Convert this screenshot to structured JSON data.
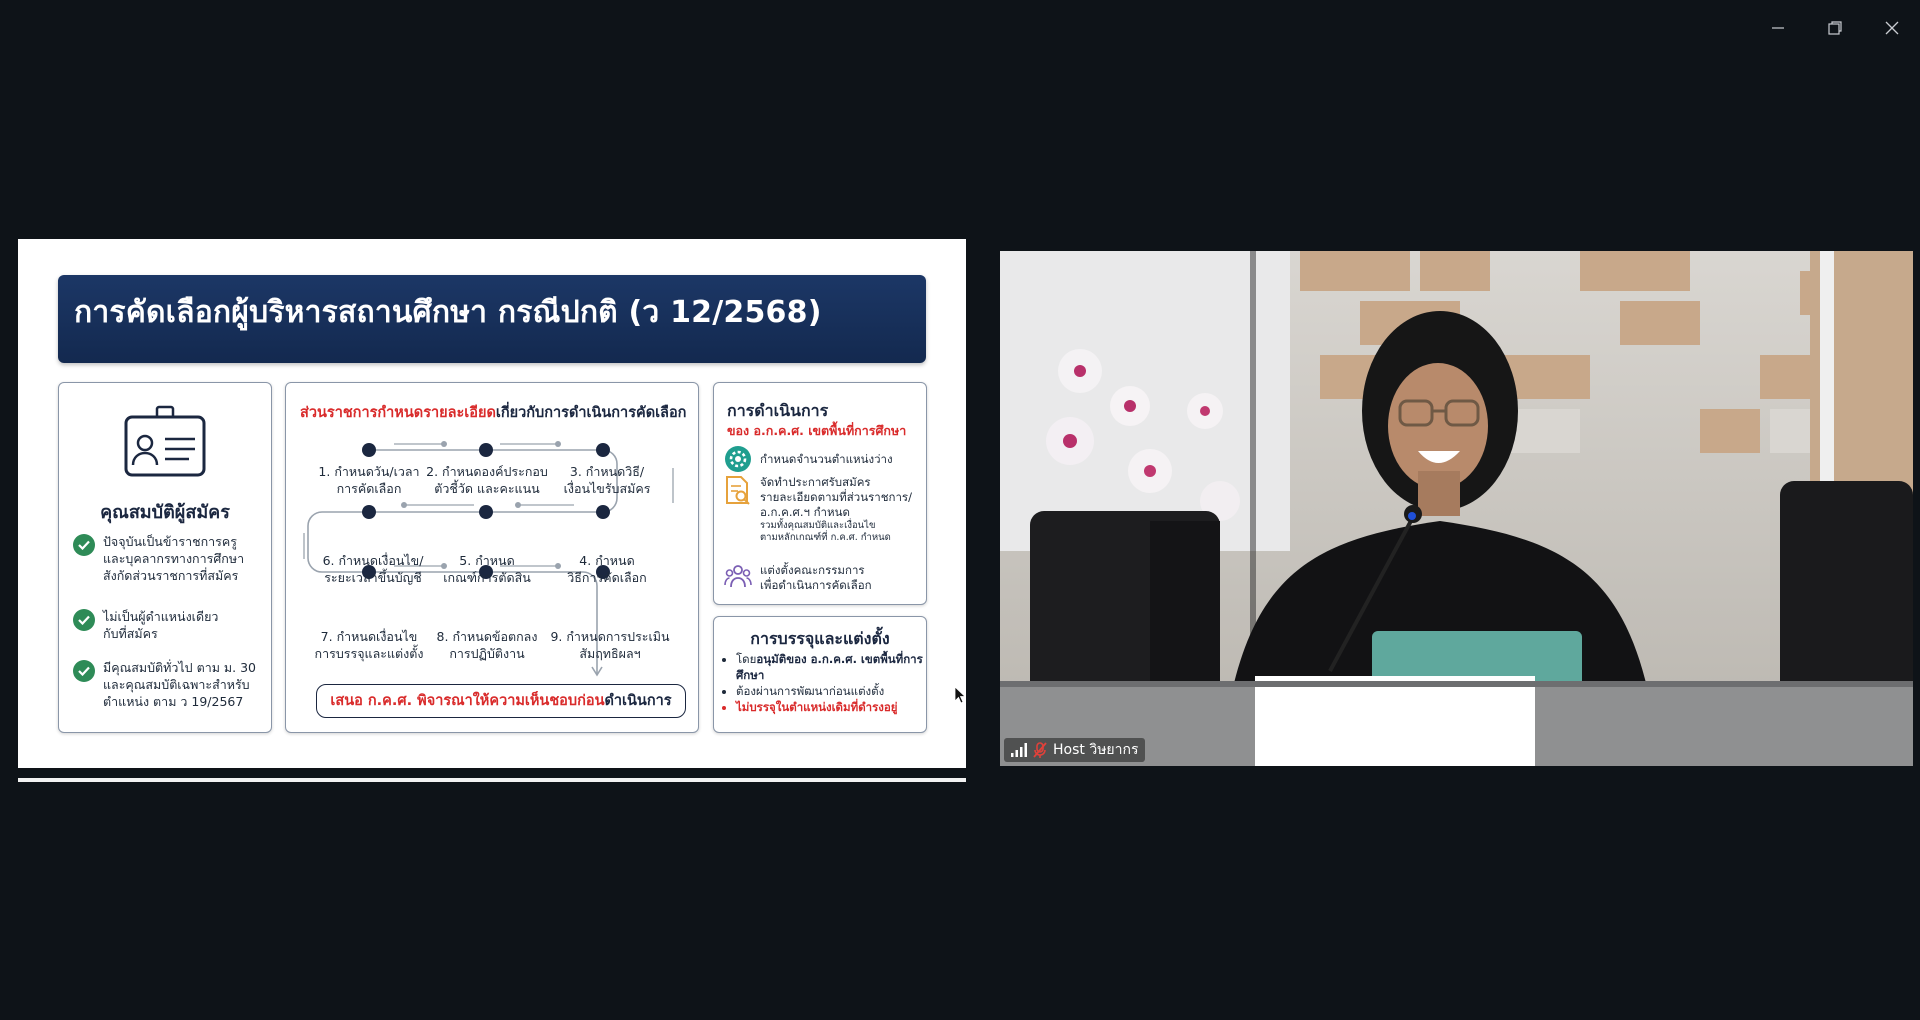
{
  "slide": {
    "title": "การคัดเลือกผู้บริหารสถานศึกษา กรณีปกติ (ว 12/2568)",
    "qualifications": {
      "title": "คุณสมบัติผู้สมัคร",
      "items": [
        [
          "ปัจจุบันเป็นข้าราชการครู",
          "และบุคลากรทางการศึกษา",
          "สังกัดส่วนราชการที่สมัคร"
        ],
        [
          "ไม่เป็นผู้ดำแหน่งเดียว",
          "กับที่สมัคร"
        ],
        [
          "มีคุณสมบัติทั่วไป ตาม ม. 30",
          "และคุณสมบัติเฉพาะสำหรับ",
          "ตำแหน่ง ตาม ว 19/2567"
        ]
      ]
    },
    "process": {
      "title_red": "ส่วนราชการกำหนดรายละเอียด",
      "title_dark": "เกี่ยวกับการดำเนินการคัดเลือก",
      "steps": [
        [
          "1. กำหนดวัน/เวลา",
          "การคัดเลือก"
        ],
        [
          "2. กำหนดองค์ประกอบ",
          "ตัวชี้วัด และคะแนน"
        ],
        [
          "3. กำหนดวิธี/",
          "เงื่อนไขรับสมัคร"
        ],
        [
          "4. กำหนด",
          "วิธีการคัดเลือก"
        ],
        [
          "5. กำหนด",
          "เกณฑ์การตัดสิน"
        ],
        [
          "6. กำหนดเงื่อนไข/",
          "ระยะเวลาขึ้นบัญชี"
        ],
        [
          "7. กำหนดเงื่อนไข",
          "การบรรจุและแต่งตั้ง"
        ],
        [
          "8. กำหนดข้อตกลง",
          "การปฏิบัติงาน"
        ],
        [
          "9. กำหนดการประเมิน",
          "สัมฤทธิผลฯ"
        ]
      ],
      "propose_red": "เสนอ ก.ค.ศ. พิจารณาให้ความเห็นชอบก่อน",
      "propose_dark": "ดำเนินการ"
    },
    "operation": {
      "title": "การดำเนินการ",
      "subtitle": "ของ อ.ก.ค.ศ. เขตพื้นที่การศึกษา",
      "items": [
        {
          "lines": [
            "กำหนดจำนวนตำแหน่งว่าง"
          ],
          "small": []
        },
        {
          "lines": [
            "จัดทำประกาศรับสมัคร",
            "รายละเอียดตามที่ส่วนราชการ/",
            "อ.ก.ค.ศ.ฯ กำหนด"
          ],
          "small": [
            "รวมทั้งคุณสมบัติและเงื่อนไข",
            "ตามหลักเกณฑ์ที่ ก.ค.ศ. กำหนด"
          ]
        },
        {
          "lines": [
            "แต่งตั้งคณะกรรมการ",
            "เพื่อดำเนินการคัดเลือก"
          ],
          "small": []
        }
      ]
    },
    "appointment": {
      "title": "การบรรจุและแต่งตั้ง",
      "item1_pre": "โดย",
      "item1_bold": "อนุมัติของ อ.ก.ค.ศ. เขตพื้นที่การศึกษา",
      "item2": "ต้องผ่านการพัฒนาก่อนแต่งตั้ง",
      "item3": "ไม่บรรจุในตำแหน่งเดิมที่ดำรงอยู่"
    }
  },
  "video": {
    "participant_label": "Host วิษยากร"
  },
  "window": {
    "minimize_icon": "minimize-icon",
    "restore_icon": "restore-icon",
    "close_icon": "close-icon"
  }
}
